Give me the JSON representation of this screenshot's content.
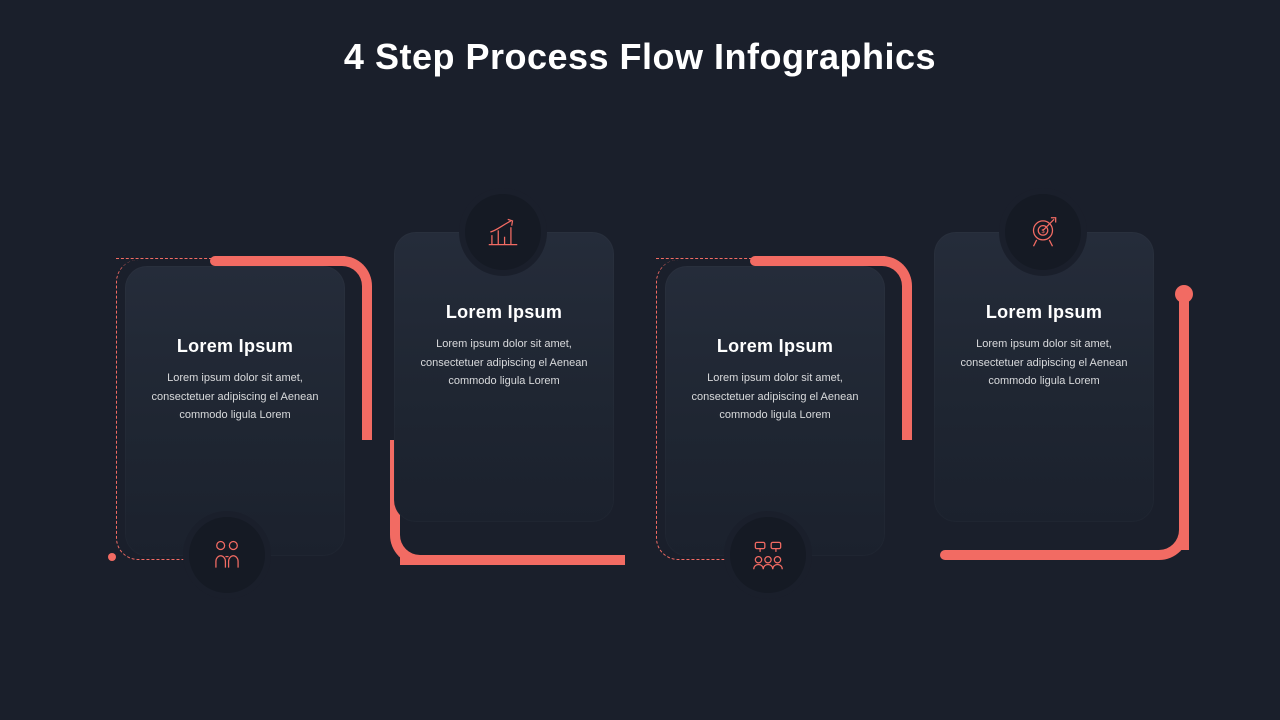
{
  "title": "4 Step Process Flow Infographics",
  "accent": "#f26b63",
  "steps": [
    {
      "icon": "people-icon",
      "heading": "Lorem Ipsum",
      "body": "Lorem ipsum dolor sit amet, consectetuer adipiscing el Aenean commodo ligula Lorem"
    },
    {
      "icon": "growth-icon",
      "heading": "Lorem Ipsum",
      "body": "Lorem ipsum dolor sit amet, consectetuer adipiscing el Aenean commodo ligula Lorem"
    },
    {
      "icon": "team-icon",
      "heading": "Lorem Ipsum",
      "body": "Lorem ipsum dolor sit amet, consectetuer adipiscing el Aenean commodo ligula Lorem"
    },
    {
      "icon": "target-icon",
      "heading": "Lorem Ipsum",
      "body": "Lorem ipsum dolor sit amet, consectetuer adipiscing el Aenean commodo ligula Lorem"
    }
  ]
}
